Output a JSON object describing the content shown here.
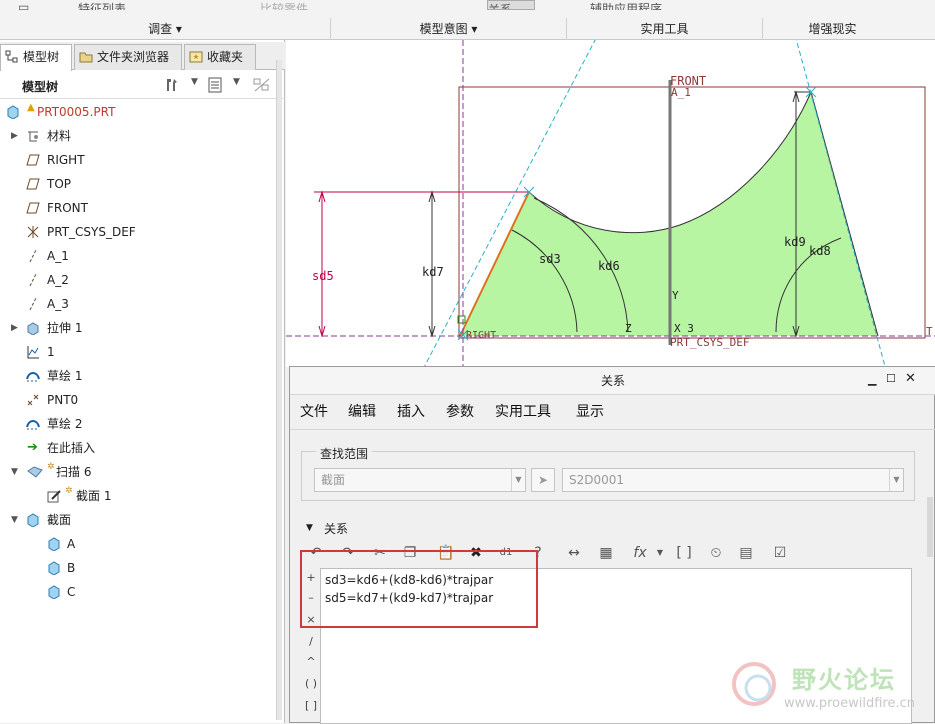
{
  "ribbon": {
    "top_items": [
      "特征列表",
      "比较零件",
      "关系",
      "辅助应用程序"
    ],
    "groups": [
      "调查 ▾",
      "模型意图 ▾",
      "实用工具",
      "增强现实"
    ]
  },
  "tree_tabs": [
    "模型树",
    "文件夹浏览器",
    "收藏夹"
  ],
  "tree_header": "模型树",
  "tree_items": [
    {
      "label": "PRT0005.PRT"
    },
    {
      "label": "材料"
    },
    {
      "label": "RIGHT"
    },
    {
      "label": "TOP"
    },
    {
      "label": "FRONT"
    },
    {
      "label": "PRT_CSYS_DEF"
    },
    {
      "label": "A_1"
    },
    {
      "label": "A_2"
    },
    {
      "label": "A_3"
    },
    {
      "label": "拉伸 1"
    },
    {
      "label": "1"
    },
    {
      "label": "草绘 1"
    },
    {
      "label": "PNT0"
    },
    {
      "label": "草绘 2"
    },
    {
      "label": "在此插入"
    },
    {
      "label": "扫描 6"
    },
    {
      "label": "截面 1"
    },
    {
      "label": "截面"
    },
    {
      "label": "A"
    },
    {
      "label": "B"
    },
    {
      "label": "C"
    }
  ],
  "sketch": {
    "labels": {
      "front": "FRONT",
      "a1": "A_1",
      "sd5": "sd5",
      "kd7": "kd7",
      "sd3": "sd3",
      "kd6": "kd6",
      "kd9": "kd9",
      "kd8": "kd8",
      "y": "Y",
      "z": "Z",
      "x3": "X 3",
      "csys": "PRT_CSYS_DEF",
      "right": "RIGHT",
      "top_edge": "T"
    },
    "colors": {
      "fill": "#b7f5a3",
      "dim": "#c4004a",
      "frame": "#8a3a3a",
      "axis": "#2ab0c8"
    }
  },
  "dialog": {
    "title": "关系",
    "menus": [
      "文件",
      "编辑",
      "插入",
      "参数",
      "实用工具",
      "显示"
    ],
    "lookup_label": "查找范围",
    "combo1": "截面",
    "combo2": "S2D0001",
    "section": "关系",
    "side_buttons": [
      "+",
      "–",
      "×",
      "/",
      "^",
      "( )",
      "[ ]"
    ],
    "lines": [
      "sd3=kd6+(kd8-kd6)*trajpar",
      "sd5=kd7+(kd9-kd7)*trajpar"
    ]
  },
  "watermark": {
    "title": "野火论坛",
    "url": "www.proewildfire.cn"
  }
}
